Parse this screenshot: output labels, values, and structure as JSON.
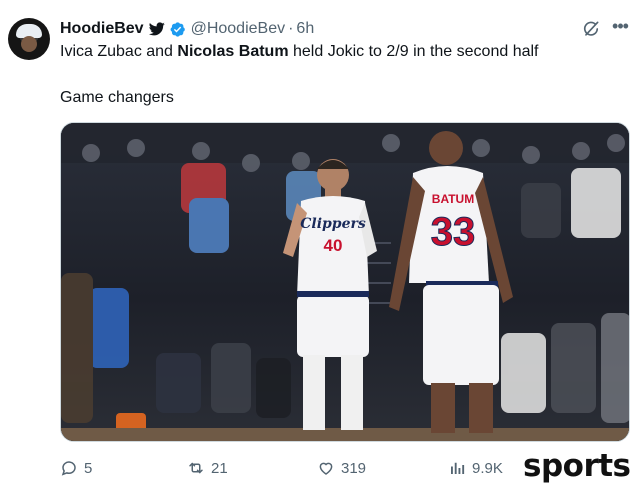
{
  "tweet": {
    "display_name": "HoodieBev",
    "handle": "@HoodieBev",
    "separator": "·",
    "time": "6h",
    "text_part1": "Ivica Zubac and ",
    "text_bold": "Nicolas Batum",
    "text_part2": " held Jokic to 2/9 in the second half",
    "text_line2": "Game changers",
    "icons": {
      "twitter": "bird-icon",
      "verified": "verified-badge-icon",
      "grok": "grok-icon",
      "more": "more-icon"
    }
  },
  "media": {
    "player_left": {
      "team": "Clippers",
      "number": "40"
    },
    "player_right": {
      "name": "BATUM",
      "number": "33"
    }
  },
  "actions": {
    "replies": "5",
    "retweets": "21",
    "likes": "319",
    "views": "9.9K"
  },
  "watermark": "sports",
  "colors": {
    "text": "#0f1419",
    "muted": "#536471",
    "verified": "#1d9bf0",
    "jersey_red": "#c8102e"
  }
}
